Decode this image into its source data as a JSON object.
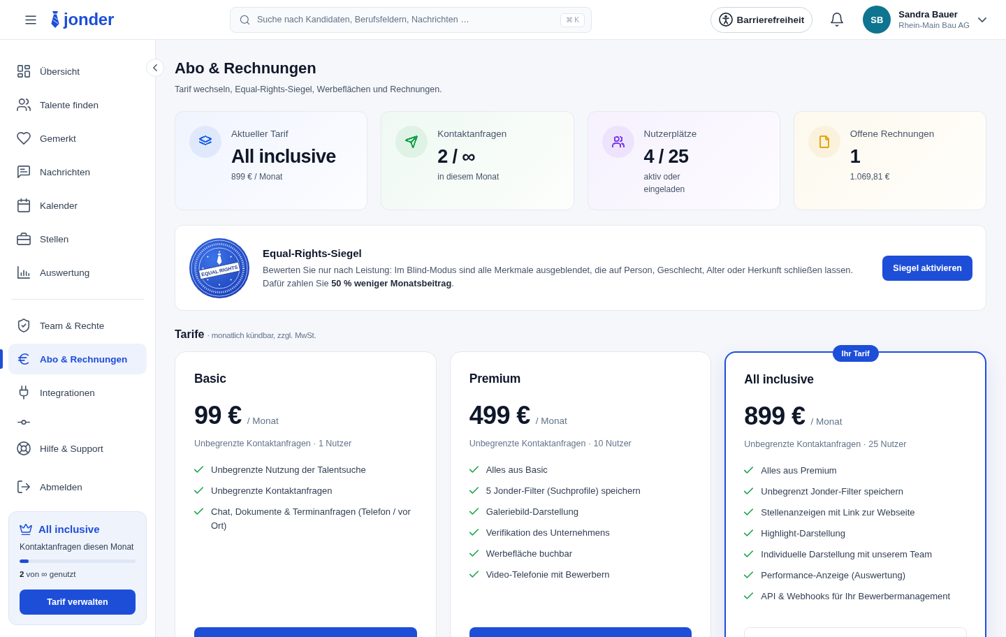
{
  "header": {
    "logo": "jonder",
    "search": {
      "placeholder": "Suche nach Kandidaten, Berufsfeldern, Nachrichten …",
      "shortcut": "⌘ K"
    },
    "accessibility_button": "Barrierefreiheit",
    "user": {
      "initials": "SB",
      "name": "Sandra Bauer",
      "company": "Rhein-Main Bau AG"
    }
  },
  "sidebar": {
    "main_items": [
      {
        "label": "Übersicht",
        "selected": false
      },
      {
        "label": "Talente finden",
        "selected": false
      },
      {
        "label": "Gemerkt",
        "selected": false
      },
      {
        "label": "Nachrichten",
        "selected": false
      },
      {
        "label": "Kalender",
        "selected": false
      },
      {
        "label": "Stellen",
        "selected": false
      },
      {
        "label": "Auswertung",
        "selected": false
      }
    ],
    "admin_items": [
      {
        "label": "Team & Rechte",
        "selected": false
      },
      {
        "label": "Abo & Rechnungen",
        "selected": true
      },
      {
        "label": "Integrationen",
        "selected": false
      },
      {
        "selected": false
      }
    ],
    "footer_items": [
      {
        "label": "Hilfe & Support"
      },
      {
        "label": "Abmelden"
      }
    ]
  },
  "plan_widget": {
    "title": "All inclusive",
    "caption": "Kontaktanfragen diesen Monat",
    "level": 0.08,
    "usage": "**2** von ∞ genutzt",
    "button": "Tarif verwalten"
  },
  "page": {
    "title": "Abo & Rechnungen",
    "subtitle": "Tarif wechseln, Equal-Rights-Siegel, Werbeflächen und Rechnungen."
  },
  "stats": [
    {
      "label": "Aktueller Tarif",
      "value": "All inclusive",
      "note": "899 € / Monat",
      "color": "#2563eb"
    },
    {
      "label": "Kontaktanfragen",
      "value": "2 / ∞",
      "note": "in diesem Monat",
      "color": "#16a34a"
    },
    {
      "label": "Nutzerplätze",
      "value": "4 / 25",
      "note": "aktiv oder eingeladen",
      "color": "#7c3aed"
    },
    {
      "label": "Offene Rechnungen",
      "value": "1",
      "note": "1.069,81 €",
      "color": "#e5a50a"
    }
  ],
  "equal_rights": {
    "seal_label": "EQUAL RIGHTS",
    "title": "Equal-Rights-Siegel",
    "description": "Bewerten Sie nur nach Leistung: Im Blind-Modus sind alle Merkmale ausgeblendet, die auf Person, Geschlecht, Alter oder Herkunft schließen lassen. Dafür zahlen Sie **50 % weniger Monatsbeitrag**.",
    "button": "Siegel aktivieren"
  },
  "tariffs": {
    "title": "Tarife",
    "note": "· monatlich kündbar, zzgl. MwSt.",
    "plans": [
      {
        "name": "Basic",
        "price": "99 €",
        "period": "/ Monat",
        "summary": "Unbegrenzte Kontaktanfragen · 1 Nutzer",
        "features": [
          "Unbegrenzte Nutzung der Talentsuche",
          "Unbegrenzte Kontaktanfragen",
          "Chat, Dokumente & Terminanfragen (Telefon / vor Ort)"
        ],
        "selected": false
      },
      {
        "name": "Premium",
        "price": "499 €",
        "period": "/ Monat",
        "summary": "Unbegrenzte Kontaktanfragen · 10 Nutzer",
        "features": [
          "Alles aus Basic",
          "5 Jonder-Filter (Suchprofile) speichern",
          "Galeriebild-Darstellung",
          "Verifikation des Unternehmens",
          "Werbefläche buchbar",
          "Video-Telefonie mit Bewerbern"
        ],
        "selected": false
      },
      {
        "name": "All inclusive",
        "badge": "Ihr Tarif",
        "price": "899 €",
        "period": "/ Monat",
        "summary": "Unbegrenzte Kontaktanfragen · 25 Nutzer",
        "features": [
          "Alles aus Premium",
          "Unbegrenzt Jonder-Filter speichern",
          "Stellenanzeigen mit Link zur Webseite",
          "Highlight-Darstellung",
          "Individuelle Darstellung mit unserem Team",
          "Performance-Anzeige (Auswertung)",
          "API & Webhooks für Ihr Bewerbermanagement"
        ],
        "selected": true
      }
    ]
  }
}
